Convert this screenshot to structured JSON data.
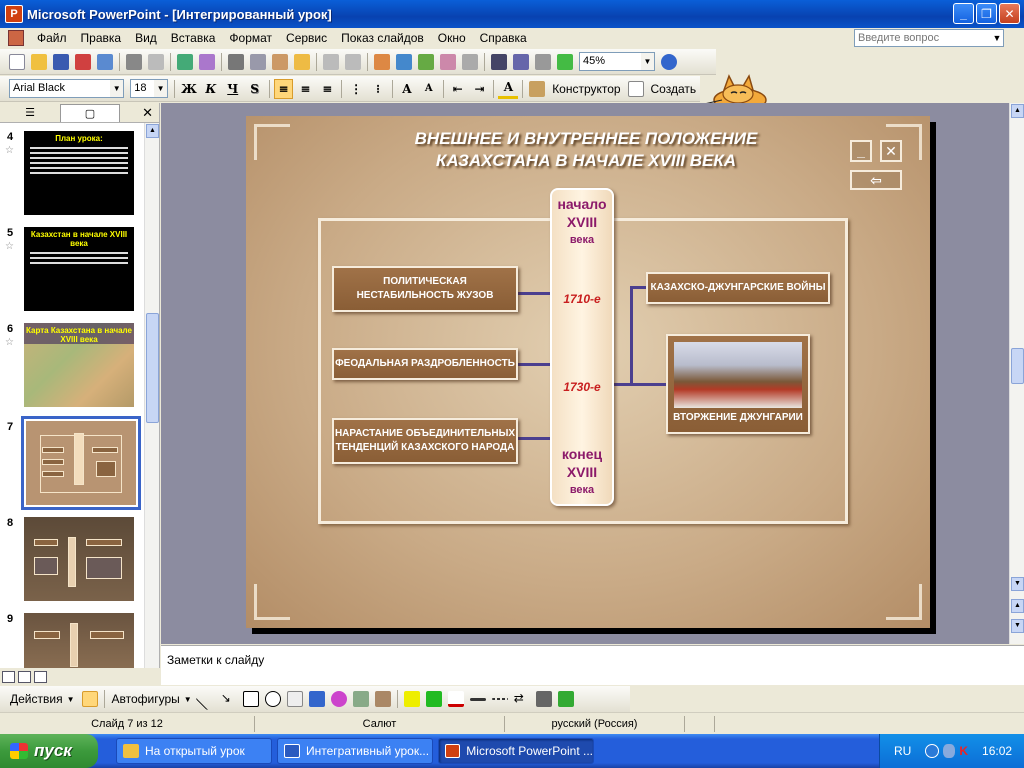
{
  "window": {
    "title": "Microsoft PowerPoint - [Интегрированный урок]"
  },
  "menu": {
    "items": [
      "Файл",
      "Правка",
      "Вид",
      "Вставка",
      "Формат",
      "Сервис",
      "Показ слайдов",
      "Окно",
      "Справка"
    ],
    "help_placeholder": "Введите вопрос"
  },
  "toolbar": {
    "zoom": "45%"
  },
  "format_bar": {
    "font": "Arial Black",
    "size": "18",
    "bold": "Ж",
    "italic": "К",
    "underline": "Ч",
    "shadow": "S",
    "design_label": "Конструктор",
    "create_label": "Создать"
  },
  "slides_pane": {
    "thumbs": [
      {
        "num": "4",
        "title": "План урока:"
      },
      {
        "num": "5",
        "title": "Казахстан в начале XVIII века"
      },
      {
        "num": "6",
        "title": "Карта Казахстана в начале XVIII века"
      },
      {
        "num": "7"
      },
      {
        "num": "8"
      },
      {
        "num": "9"
      }
    ]
  },
  "slide": {
    "title_line1": "ВНЕШНЕЕ И ВНУТРЕННЕЕ ПОЛОЖЕНИЕ",
    "title_line2": "КАЗАХСТАНА В НАЧАЛЕ XVIII ВЕКА",
    "timeline": {
      "start_1": "начало",
      "start_2": "XVIII",
      "start_3": "века",
      "mark_1": "1710-е",
      "mark_2": "1730-е",
      "end_1": "конец",
      "end_2": "XVIII",
      "end_3": "века"
    },
    "left_boxes": [
      "ПОЛИТИЧЕСКАЯ НЕСТАБИЛЬНОСТЬ ЖУЗОВ",
      "ФЕОДАЛЬНАЯ РАЗДРОБЛЕННОСТЬ",
      "НАРАСТАНИЕ ОБЪЕДИНИТЕЛЬНЫХ ТЕНДЕНЦИЙ КАЗАХСКОГО НАРОДА"
    ],
    "right_box": "КАЗАХСКО-ДЖУНГАРСКИЕ ВОЙНЫ",
    "picture_caption": "ВТОРЖЕНИЕ ДЖУНГАРИИ"
  },
  "notes": {
    "placeholder": "Заметки к слайду"
  },
  "drawing_bar": {
    "actions_label": "Действия",
    "autoshapes_label": "Автофигуры"
  },
  "status": {
    "slide_info": "Слайд 7 из 12",
    "design": "Салют",
    "language": "русский (Россия)"
  },
  "taskbar": {
    "start": "пуск",
    "tasks": [
      "На открытый урок",
      "Интегративный урок...",
      "Microsoft PowerPoint ..."
    ],
    "lang": "RU",
    "time": "16:02"
  }
}
